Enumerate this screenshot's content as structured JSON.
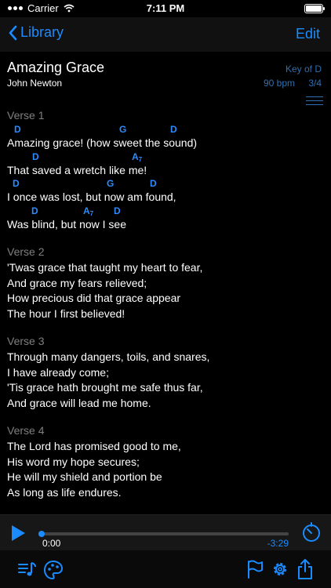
{
  "status_bar": {
    "carrier": "Carrier",
    "time": "7:11 PM"
  },
  "nav": {
    "back_label": "Library",
    "edit_label": "Edit"
  },
  "song": {
    "title": "Amazing Grace",
    "author": "John Newton",
    "key": "Key of D",
    "tempo": "90 bpm",
    "time_signature": "3/4"
  },
  "verses": [
    {
      "label": "Verse 1",
      "lines": [
        {
          "text": "Amazing grace! (how sweet the sound)",
          "chords": [
            "D",
            "G",
            "D"
          ]
        },
        {
          "text": "That saved a wretch like me!",
          "chords": [
            "D",
            "A7"
          ]
        },
        {
          "text": "I once was lost, but now am found,",
          "chords": [
            "D",
            "G",
            "D"
          ]
        },
        {
          "text": "Was blind, but now I see",
          "chords": [
            "D",
            "A7",
            "D"
          ]
        }
      ]
    },
    {
      "label": "Verse 2",
      "lines": [
        {
          "text": "'Twas grace that taught my heart to fear,"
        },
        {
          "text": "And grace my fears relieved;"
        },
        {
          "text": "How precious did that grace appear"
        },
        {
          "text": "The hour I first believed!"
        }
      ]
    },
    {
      "label": "Verse 3",
      "lines": [
        {
          "text": "Through many dangers, toils, and snares,"
        },
        {
          "text": "I have already come;"
        },
        {
          "text": "'Tis grace hath brought me safe thus far,"
        },
        {
          "text": "And grace will lead me home."
        }
      ]
    },
    {
      "label": "Verse 4",
      "lines": [
        {
          "text": "The Lord has promised good to me,"
        },
        {
          "text": "His word my hope secures;"
        },
        {
          "text": "He will my shield and portion be"
        },
        {
          "text": "As long as life endures."
        }
      ]
    }
  ],
  "player": {
    "elapsed": "0:00",
    "remaining": "-3:29",
    "progress": 0
  },
  "icons": {
    "play": "play-icon",
    "timer": "timer-icon",
    "playlist": "playlist-icon",
    "palette": "palette-icon",
    "flag": "flag-icon",
    "settings": "gear-icon",
    "share": "share-icon"
  },
  "colors": {
    "accent": "#1a8cff",
    "chord": "#2a8cff",
    "muted": "#7f7f7f",
    "background": "#000000"
  }
}
